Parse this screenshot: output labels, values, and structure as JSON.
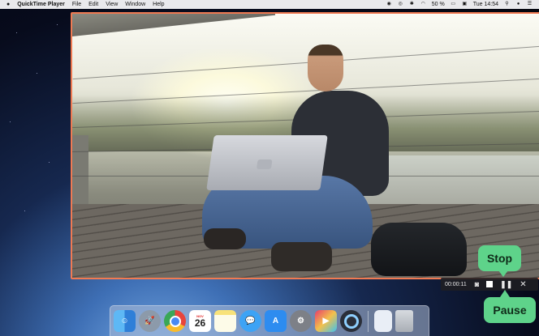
{
  "menubar": {
    "apple": "",
    "app_name": "QuickTime Player",
    "menus": [
      "File",
      "Edit",
      "View",
      "Window",
      "Help"
    ],
    "battery": "50 %",
    "time": "Tue 14:54"
  },
  "recording": {
    "elapsed": "00:00:11",
    "stop_label": "Stop",
    "pause_label": "Pause"
  },
  "dock": {
    "items": [
      "Finder",
      "Launchpad",
      "Chrome",
      "Calendar",
      "Notes",
      "Messages",
      "App Store",
      "System Preferences",
      "Movavi",
      "QuickTime Player",
      "Document",
      "Trash"
    ],
    "calendar_day": "26",
    "calendar_month": "NOV"
  },
  "colors": {
    "callout": "#5ed38a",
    "selection_border": "#f07a52"
  }
}
